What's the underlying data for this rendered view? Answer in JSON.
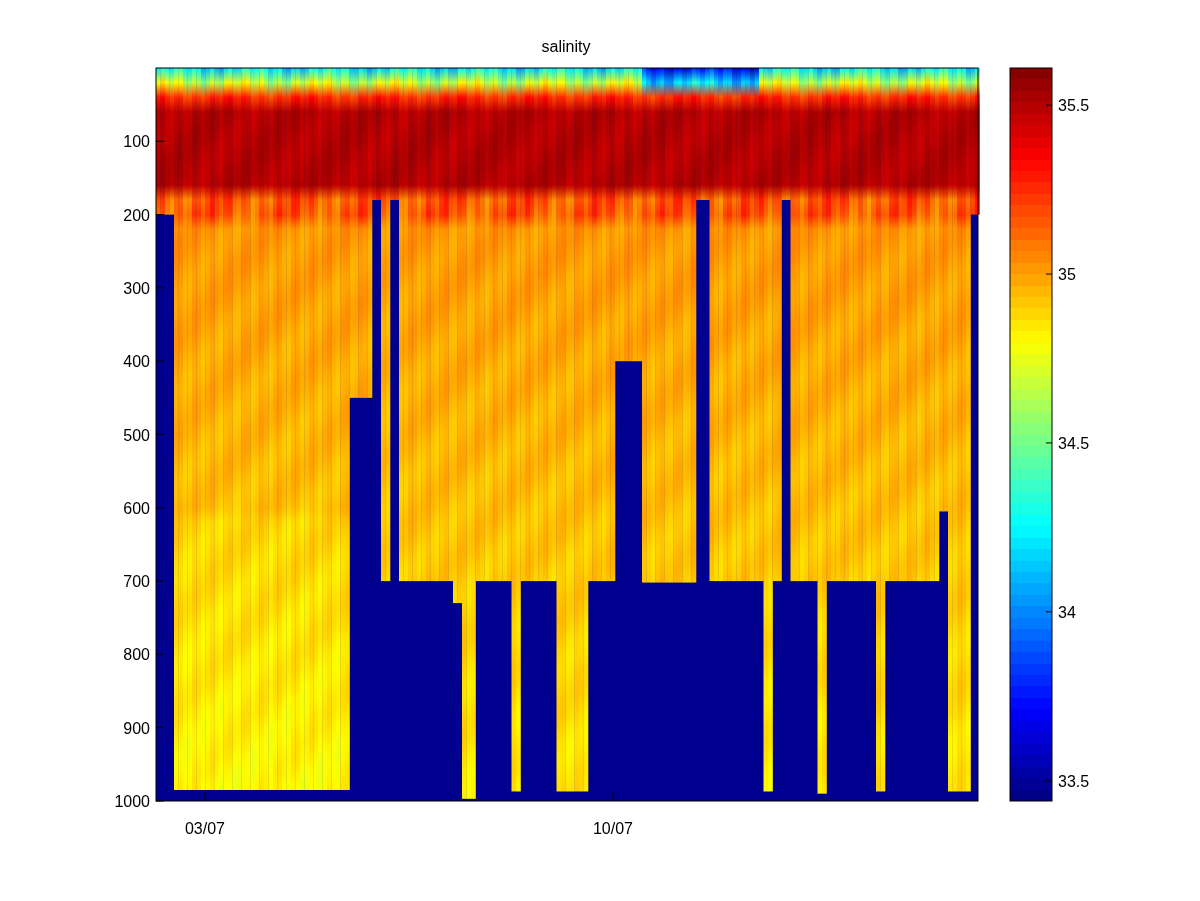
{
  "title": "salinity",
  "y_ticks": [
    "100",
    "200",
    "300",
    "400",
    "500",
    "600",
    "700",
    "800",
    "900",
    "1000"
  ],
  "x_ticks": [
    "03/07",
    "10/07"
  ],
  "colorbar_ticks": [
    "35.5",
    "35",
    "34.5",
    "34",
    "33.5"
  ]
}
